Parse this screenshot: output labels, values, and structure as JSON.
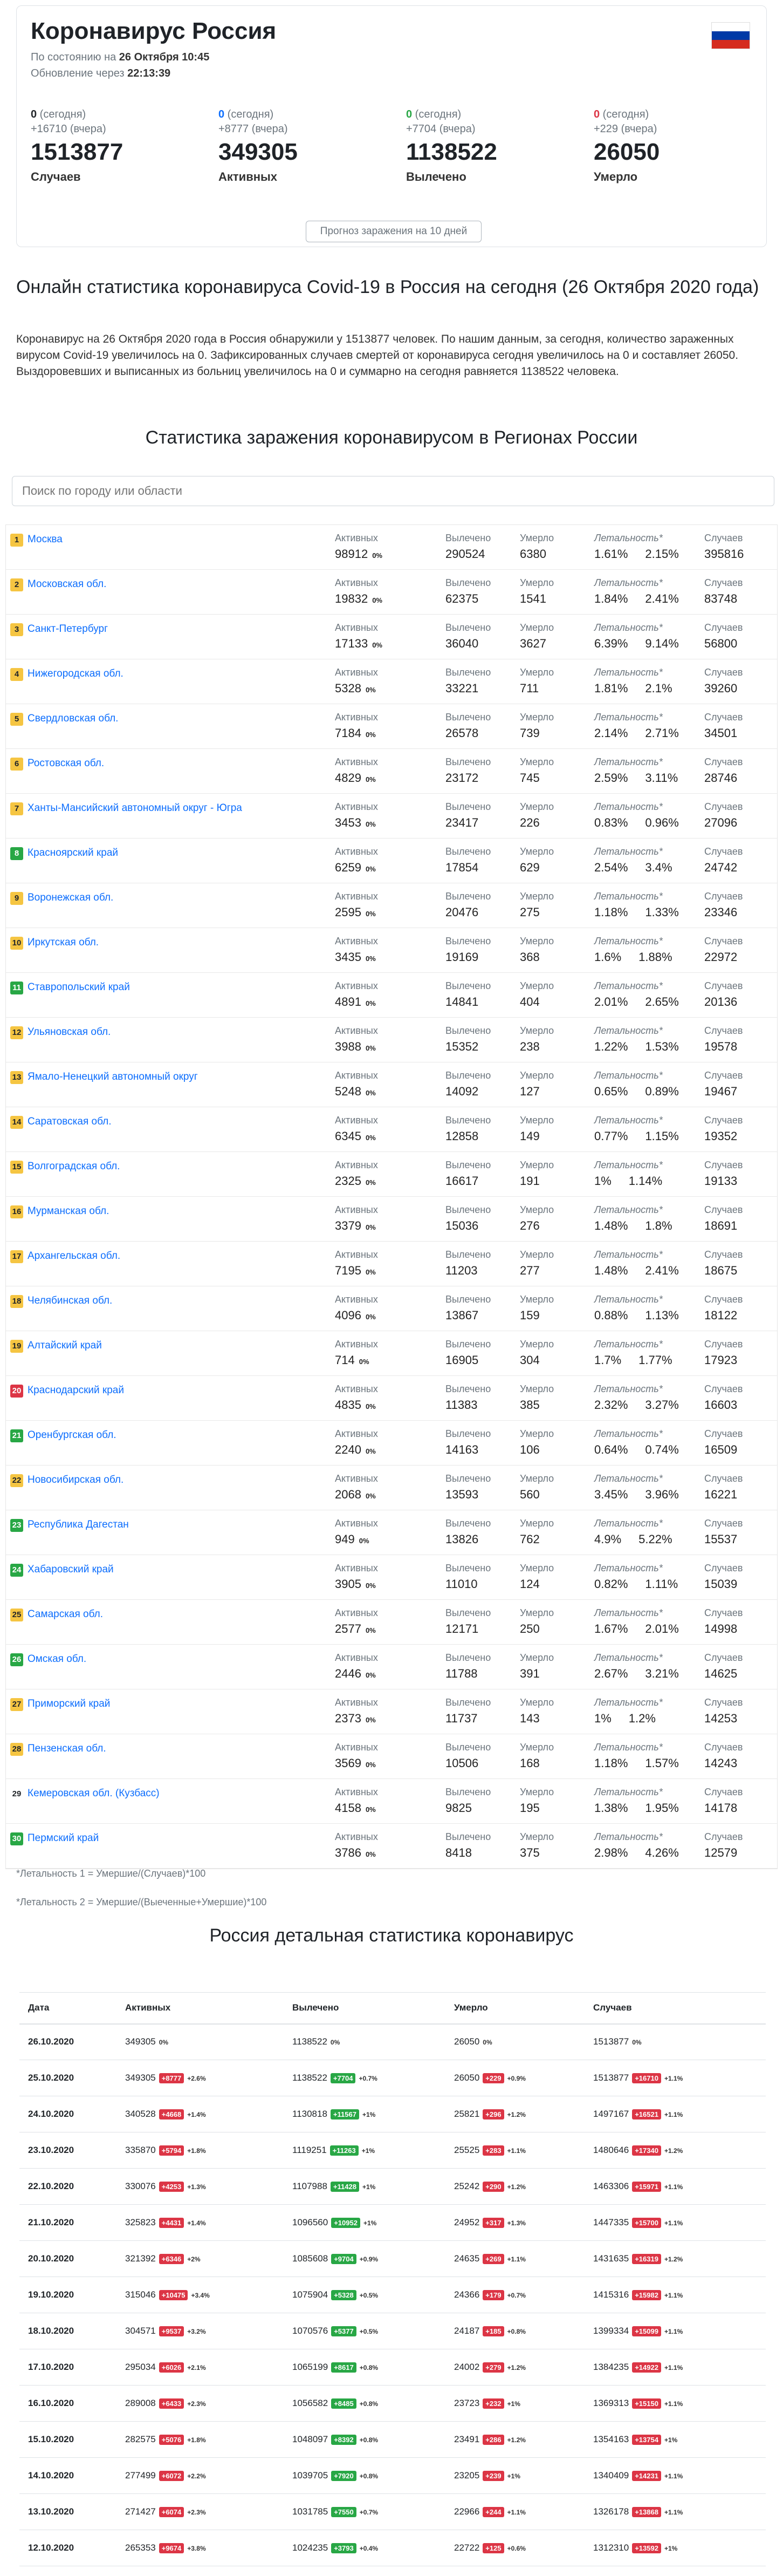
{
  "header": {
    "title": "Коронавирус Россия",
    "status_prefix": "По состоянию на ",
    "status_date": "26 Октября 10:45",
    "update_prefix": "Обновление через ",
    "update_timer": "22:13:39",
    "flag_colors": [
      "#ffffff",
      "#0039a6",
      "#d52b1e"
    ]
  },
  "stats": [
    {
      "today": "0",
      "today_label": "(сегодня)",
      "yesterday": "+16710",
      "yesterday_label": "(вчера)",
      "total": "1513877",
      "label": "Случаев",
      "color": "#212529"
    },
    {
      "today": "0",
      "today_label": "(сегодня)",
      "yesterday": "+8777",
      "yesterday_label": "(вчера)",
      "total": "349305",
      "label": "Активных",
      "color": "#0d6efd"
    },
    {
      "today": "0",
      "today_label": "(сегодня)",
      "yesterday": "+7704",
      "yesterday_label": "(вчера)",
      "total": "1138522",
      "label": "Вылечено",
      "color": "#28a745"
    },
    {
      "today": "0",
      "today_label": "(сегодня)",
      "yesterday": "+229",
      "yesterday_label": "(вчера)",
      "total": "26050",
      "label": "Умерло",
      "color": "#dc3545"
    }
  ],
  "forecast_button": "Прогноз заражения на 10 дней",
  "intro": {
    "heading": "Онлайн статистика коронавируса Covid-19 в Россия на сегодня (26 Октября 2020 года)",
    "paragraph": "Коронавирус на 26 Октября 2020 года в Россия обнаружили у 1513877 человек. По нашим данным, за сегодня, количество зараженных вирусом Covid-19 увеличилось на 0. Зафиксированных случаев смертей от коронавируса сегодня увеличилось на 0 и составляет 26050. Выздоровевших и выписанных из больниц увеличилось на 0 и суммарно на сегодня равняется 1138522 человека."
  },
  "regions_section": {
    "title": "Статистика заражения коронавирусом в Регионах России",
    "search_placeholder": "Поиск по городу или области",
    "col_labels": {
      "active": "Активных",
      "recovered": "Вылечено",
      "died": "Умерло",
      "lethality": "Летальность*",
      "cases": "Случаев"
    },
    "rows": [
      {
        "rank": "1",
        "badge": "yellow",
        "name": "Москва",
        "active": "98912",
        "active_delta": "0%",
        "recovered": "290524",
        "died": "6380",
        "l1": "1.61%",
        "l2": "2.15%",
        "cases": "395816"
      },
      {
        "rank": "2",
        "badge": "yellow",
        "name": "Московская обл.",
        "active": "19832",
        "active_delta": "0%",
        "recovered": "62375",
        "died": "1541",
        "l1": "1.84%",
        "l2": "2.41%",
        "cases": "83748"
      },
      {
        "rank": "3",
        "badge": "yellow",
        "name": "Санкт-Петербург",
        "active": "17133",
        "active_delta": "0%",
        "recovered": "36040",
        "died": "3627",
        "l1": "6.39%",
        "l2": "9.14%",
        "cases": "56800"
      },
      {
        "rank": "4",
        "badge": "yellow",
        "name": "Нижегородская обл.",
        "active": "5328",
        "active_delta": "0%",
        "recovered": "33221",
        "died": "711",
        "l1": "1.81%",
        "l2": "2.1%",
        "cases": "39260"
      },
      {
        "rank": "5",
        "badge": "yellow",
        "name": "Свердловская обл.",
        "active": "7184",
        "active_delta": "0%",
        "recovered": "26578",
        "died": "739",
        "l1": "2.14%",
        "l2": "2.71%",
        "cases": "34501"
      },
      {
        "rank": "6",
        "badge": "yellow",
        "name": "Ростовская обл.",
        "active": "4829",
        "active_delta": "0%",
        "recovered": "23172",
        "died": "745",
        "l1": "2.59%",
        "l2": "3.11%",
        "cases": "28746"
      },
      {
        "rank": "7",
        "badge": "yellow",
        "name": "Ханты-Мансийский автономный округ - Югра",
        "active": "3453",
        "active_delta": "0%",
        "recovered": "23417",
        "died": "226",
        "l1": "0.83%",
        "l2": "0.96%",
        "cases": "27096"
      },
      {
        "rank": "8",
        "badge": "green",
        "name": "Красноярский край",
        "active": "6259",
        "active_delta": "0%",
        "recovered": "17854",
        "died": "629",
        "l1": "2.54%",
        "l2": "3.4%",
        "cases": "24742"
      },
      {
        "rank": "9",
        "badge": "yellow",
        "name": "Воронежская обл.",
        "active": "2595",
        "active_delta": "0%",
        "recovered": "20476",
        "died": "275",
        "l1": "1.18%",
        "l2": "1.33%",
        "cases": "23346"
      },
      {
        "rank": "10",
        "badge": "yellow",
        "name": "Иркутская обл.",
        "active": "3435",
        "active_delta": "0%",
        "recovered": "19169",
        "died": "368",
        "l1": "1.6%",
        "l2": "1.88%",
        "cases": "22972"
      },
      {
        "rank": "11",
        "badge": "green",
        "name": "Ставропольский край",
        "active": "4891",
        "active_delta": "0%",
        "recovered": "14841",
        "died": "404",
        "l1": "2.01%",
        "l2": "2.65%",
        "cases": "20136"
      },
      {
        "rank": "12",
        "badge": "yellow",
        "name": "Ульяновская обл.",
        "active": "3988",
        "active_delta": "0%",
        "recovered": "15352",
        "died": "238",
        "l1": "1.22%",
        "l2": "1.53%",
        "cases": "19578"
      },
      {
        "rank": "13",
        "badge": "yellow",
        "name": "Ямало-Ненецкий автономный округ",
        "active": "5248",
        "active_delta": "0%",
        "recovered": "14092",
        "died": "127",
        "l1": "0.65%",
        "l2": "0.89%",
        "cases": "19467"
      },
      {
        "rank": "14",
        "badge": "yellow",
        "name": "Саратовская обл.",
        "active": "6345",
        "active_delta": "0%",
        "recovered": "12858",
        "died": "149",
        "l1": "0.77%",
        "l2": "1.15%",
        "cases": "19352"
      },
      {
        "rank": "15",
        "badge": "yellow",
        "name": "Волгоградская обл.",
        "active": "2325",
        "active_delta": "0%",
        "recovered": "16617",
        "died": "191",
        "l1": "1%",
        "l2": "1.14%",
        "cases": "19133"
      },
      {
        "rank": "16",
        "badge": "yellow",
        "name": "Мурманская обл.",
        "active": "3379",
        "active_delta": "0%",
        "recovered": "15036",
        "died": "276",
        "l1": "1.48%",
        "l2": "1.8%",
        "cases": "18691"
      },
      {
        "rank": "17",
        "badge": "yellow",
        "name": "Архангельская обл.",
        "active": "7195",
        "active_delta": "0%",
        "recovered": "11203",
        "died": "277",
        "l1": "1.48%",
        "l2": "2.41%",
        "cases": "18675"
      },
      {
        "rank": "18",
        "badge": "yellow",
        "name": "Челябинская обл.",
        "active": "4096",
        "active_delta": "0%",
        "recovered": "13867",
        "died": "159",
        "l1": "0.88%",
        "l2": "1.13%",
        "cases": "18122"
      },
      {
        "rank": "19",
        "badge": "yellow",
        "name": "Алтайский край",
        "active": "714",
        "active_delta": "0%",
        "recovered": "16905",
        "died": "304",
        "l1": "1.7%",
        "l2": "1.77%",
        "cases": "17923"
      },
      {
        "rank": "20",
        "badge": "red",
        "name": "Краснодарский край",
        "active": "4835",
        "active_delta": "0%",
        "recovered": "11383",
        "died": "385",
        "l1": "2.32%",
        "l2": "3.27%",
        "cases": "16603"
      },
      {
        "rank": "21",
        "badge": "green",
        "name": "Оренбургская обл.",
        "active": "2240",
        "active_delta": "0%",
        "recovered": "14163",
        "died": "106",
        "l1": "0.64%",
        "l2": "0.74%",
        "cases": "16509"
      },
      {
        "rank": "22",
        "badge": "yellow",
        "name": "Новосибирская обл.",
        "active": "2068",
        "active_delta": "0%",
        "recovered": "13593",
        "died": "560",
        "l1": "3.45%",
        "l2": "3.96%",
        "cases": "16221"
      },
      {
        "rank": "23",
        "badge": "green",
        "name": "Республика Дагестан",
        "active": "949",
        "active_delta": "0%",
        "recovered": "13826",
        "died": "762",
        "l1": "4.9%",
        "l2": "5.22%",
        "cases": "15537"
      },
      {
        "rank": "24",
        "badge": "green",
        "name": "Хабаровский край",
        "active": "3905",
        "active_delta": "0%",
        "recovered": "11010",
        "died": "124",
        "l1": "0.82%",
        "l2": "1.11%",
        "cases": "15039"
      },
      {
        "rank": "25",
        "badge": "yellow",
        "name": "Самарская обл.",
        "active": "2577",
        "active_delta": "0%",
        "recovered": "12171",
        "died": "250",
        "l1": "1.67%",
        "l2": "2.01%",
        "cases": "14998"
      },
      {
        "rank": "26",
        "badge": "green",
        "name": "Омская обл.",
        "active": "2446",
        "active_delta": "0%",
        "recovered": "11788",
        "died": "391",
        "l1": "2.67%",
        "l2": "3.21%",
        "cases": "14625"
      },
      {
        "rank": "27",
        "badge": "yellow",
        "name": "Приморский край",
        "active": "2373",
        "active_delta": "0%",
        "recovered": "11737",
        "died": "143",
        "l1": "1%",
        "l2": "1.2%",
        "cases": "14253"
      },
      {
        "rank": "28",
        "badge": "yellow",
        "name": "Пензенская обл.",
        "active": "3569",
        "active_delta": "0%",
        "recovered": "10506",
        "died": "168",
        "l1": "1.18%",
        "l2": "1.57%",
        "cases": "14243"
      },
      {
        "rank": "29",
        "badge": "none",
        "name": "Кемеровская обл. (Кузбасс)",
        "active": "4158",
        "active_delta": "0%",
        "recovered": "9825",
        "died": "195",
        "l1": "1.38%",
        "l2": "1.95%",
        "cases": "14178"
      },
      {
        "rank": "30",
        "badge": "green",
        "name": "Пермский край",
        "active": "3786",
        "active_delta": "0%",
        "recovered": "8418",
        "died": "375",
        "l1": "2.98%",
        "l2": "4.26%",
        "cases": "12579"
      }
    ],
    "notes": [
      "*Летальность 1 = Умершие/(Случаев)*100",
      "*Летальность 2 = Умершие/(Выеченные+Умершие)*100"
    ]
  },
  "history": {
    "title": "Россия детальная статистика коронавирус",
    "headers": [
      "Дата",
      "Активных",
      "Вылечено",
      "Умерло",
      "Случаев"
    ],
    "rows": [
      {
        "date": "26.10.2020",
        "active": "349305",
        "active_d": "",
        "active_p": "0%",
        "rec": "1138522",
        "rec_d": "",
        "rec_p": "0%",
        "died": "26050",
        "died_d": "",
        "died_p": "0%",
        "cases": "1513877",
        "cases_d": "",
        "cases_p": "0%"
      },
      {
        "date": "25.10.2020",
        "active": "349305",
        "active_d": "+8777",
        "active_p": "+2.6%",
        "rec": "1138522",
        "rec_d": "+7704",
        "rec_p": "+0.7%",
        "died": "26050",
        "died_d": "+229",
        "died_p": "+0.9%",
        "cases": "1513877",
        "cases_d": "+16710",
        "cases_p": "+1.1%"
      },
      {
        "date": "24.10.2020",
        "active": "340528",
        "active_d": "+4668",
        "active_p": "+1.4%",
        "rec": "1130818",
        "rec_d": "+11567",
        "rec_p": "+1%",
        "died": "25821",
        "died_d": "+296",
        "died_p": "+1.2%",
        "cases": "1497167",
        "cases_d": "+16521",
        "cases_p": "+1.1%"
      },
      {
        "date": "23.10.2020",
        "active": "335870",
        "active_d": "+5794",
        "active_p": "+1.8%",
        "rec": "1119251",
        "rec_d": "+11263",
        "rec_p": "+1%",
        "died": "25525",
        "died_d": "+283",
        "died_p": "+1.1%",
        "cases": "1480646",
        "cases_d": "+17340",
        "cases_p": "+1.2%"
      },
      {
        "date": "22.10.2020",
        "active": "330076",
        "active_d": "+4253",
        "active_p": "+1.3%",
        "rec": "1107988",
        "rec_d": "+11428",
        "rec_p": "+1%",
        "died": "25242",
        "died_d": "+290",
        "died_p": "+1.2%",
        "cases": "1463306",
        "cases_d": "+15971",
        "cases_p": "+1.1%"
      },
      {
        "date": "21.10.2020",
        "active": "325823",
        "active_d": "+4431",
        "active_p": "+1.4%",
        "rec": "1096560",
        "rec_d": "+10952",
        "rec_p": "+1%",
        "died": "24952",
        "died_d": "+317",
        "died_p": "+1.3%",
        "cases": "1447335",
        "cases_d": "+15700",
        "cases_p": "+1.1%"
      },
      {
        "date": "20.10.2020",
        "active": "321392",
        "active_d": "+6346",
        "active_p": "+2%",
        "rec": "1085608",
        "rec_d": "+9704",
        "rec_p": "+0.9%",
        "died": "24635",
        "died_d": "+269",
        "died_p": "+1.1%",
        "cases": "1431635",
        "cases_d": "+16319",
        "cases_p": "+1.2%"
      },
      {
        "date": "19.10.2020",
        "active": "315046",
        "active_d": "+10475",
        "active_p": "+3.4%",
        "rec": "1075904",
        "rec_d": "+5328",
        "rec_p": "+0.5%",
        "died": "24366",
        "died_d": "+179",
        "died_p": "+0.7%",
        "cases": "1415316",
        "cases_d": "+15982",
        "cases_p": "+1.1%"
      },
      {
        "date": "18.10.2020",
        "active": "304571",
        "active_d": "+9537",
        "active_p": "+3.2%",
        "rec": "1070576",
        "rec_d": "+5377",
        "rec_p": "+0.5%",
        "died": "24187",
        "died_d": "+185",
        "died_p": "+0.8%",
        "cases": "1399334",
        "cases_d": "+15099",
        "cases_p": "+1.1%"
      },
      {
        "date": "17.10.2020",
        "active": "295034",
        "active_d": "+6026",
        "active_p": "+2.1%",
        "rec": "1065199",
        "rec_d": "+8617",
        "rec_p": "+0.8%",
        "died": "24002",
        "died_d": "+279",
        "died_p": "+1.2%",
        "cases": "1384235",
        "cases_d": "+14922",
        "cases_p": "+1.1%"
      },
      {
        "date": "16.10.2020",
        "active": "289008",
        "active_d": "+6433",
        "active_p": "+2.3%",
        "rec": "1056582",
        "rec_d": "+8485",
        "rec_p": "+0.8%",
        "died": "23723",
        "died_d": "+232",
        "died_p": "+1%",
        "cases": "1369313",
        "cases_d": "+15150",
        "cases_p": "+1.1%"
      },
      {
        "date": "15.10.2020",
        "active": "282575",
        "active_d": "+5076",
        "active_p": "+1.8%",
        "rec": "1048097",
        "rec_d": "+8392",
        "rec_p": "+0.8%",
        "died": "23491",
        "died_d": "+286",
        "died_p": "+1.2%",
        "cases": "1354163",
        "cases_d": "+13754",
        "cases_p": "+1%"
      },
      {
        "date": "14.10.2020",
        "active": "277499",
        "active_d": "+6072",
        "active_p": "+2.2%",
        "rec": "1039705",
        "rec_d": "+7920",
        "rec_p": "+0.8%",
        "died": "23205",
        "died_d": "+239",
        "died_p": "+1%",
        "cases": "1340409",
        "cases_d": "+14231",
        "cases_p": "+1.1%"
      },
      {
        "date": "13.10.2020",
        "active": "271427",
        "active_d": "+6074",
        "active_p": "+2.3%",
        "rec": "1031785",
        "rec_d": "+7550",
        "rec_p": "+0.7%",
        "died": "22966",
        "died_d": "+244",
        "died_p": "+1.1%",
        "cases": "1326178",
        "cases_d": "+13868",
        "cases_p": "+1.1%"
      },
      {
        "date": "12.10.2020",
        "active": "265353",
        "active_d": "+9674",
        "active_p": "+3.8%",
        "rec": "1024235",
        "rec_d": "+3793",
        "rec_p": "+0.4%",
        "died": "22722",
        "died_d": "+125",
        "died_p": "+0.6%",
        "cases": "1312310",
        "cases_d": "+13592",
        "cases_p": "+1%"
      }
    ]
  }
}
